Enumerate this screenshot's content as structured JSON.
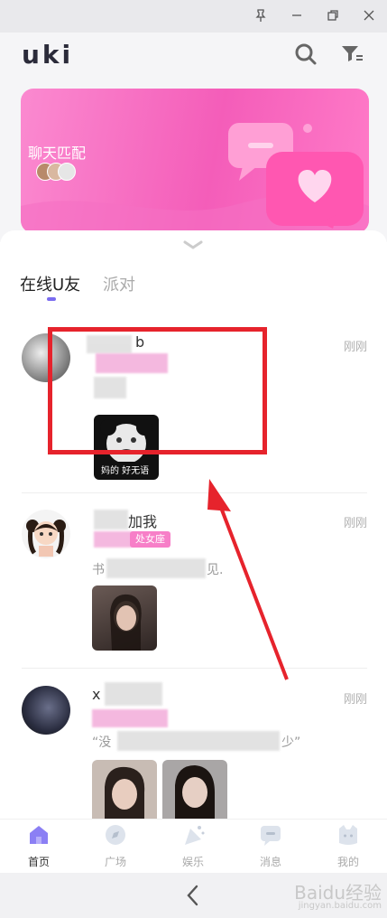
{
  "app": {
    "logo": "uki"
  },
  "banner": {
    "title": "聊天匹配"
  },
  "tabs": [
    {
      "label": "在线U友",
      "active": true
    },
    {
      "label": "派对",
      "active": false
    }
  ],
  "posts": [
    {
      "name_visible": "b",
      "time": "刚刚",
      "sticker_caption": "妈的 好无语",
      "tag": "",
      "text": ""
    },
    {
      "name_visible": "加我",
      "time": "刚刚",
      "tag": "处女座",
      "text_start": "书",
      "text_end": "见."
    },
    {
      "name_visible": "x",
      "time": "刚刚",
      "text_start": "“没",
      "text_end": "少”"
    }
  ],
  "nav": [
    {
      "label": "首页",
      "icon": "home-icon",
      "active": true
    },
    {
      "label": "广场",
      "icon": "compass-icon",
      "active": false
    },
    {
      "label": "娱乐",
      "icon": "party-icon",
      "active": false
    },
    {
      "label": "消息",
      "icon": "message-icon",
      "active": false
    },
    {
      "label": "我的",
      "icon": "profile-icon",
      "active": false
    }
  ],
  "watermark": {
    "main": "Baidu经验",
    "sub": "jingyan.baidu.com"
  },
  "colors": {
    "accent": "#7a6cf0",
    "brand_pink": "#f45db9",
    "annotation_red": "#e6232c"
  }
}
